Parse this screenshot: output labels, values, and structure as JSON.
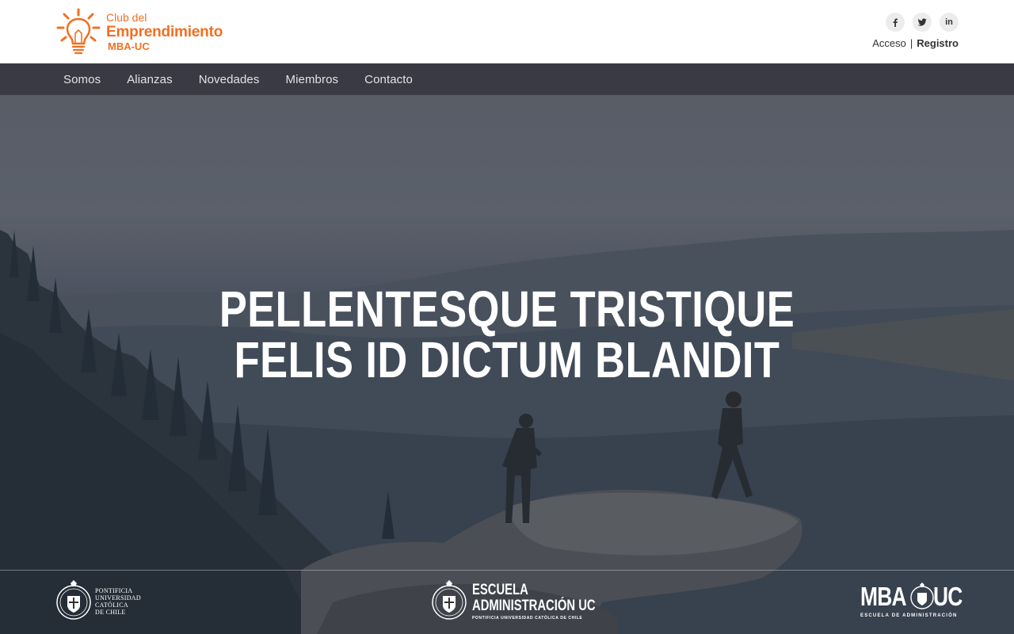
{
  "brand": {
    "line1": "Club del",
    "line2": "Emprendimiento",
    "line3": "MBA-UC",
    "color": "#f26f21"
  },
  "social": [
    {
      "icon": "facebook-icon",
      "glyph": "f"
    },
    {
      "icon": "twitter-icon",
      "glyph": ""
    },
    {
      "icon": "linkedin-icon",
      "glyph": "in"
    }
  ],
  "auth": {
    "login_label": "Acceso",
    "separator": "|",
    "register_label": "Registro"
  },
  "nav": {
    "items": [
      {
        "label": "Somos"
      },
      {
        "label": "Alianzas"
      },
      {
        "label": "Novedades"
      },
      {
        "label": "Miembros"
      },
      {
        "label": "Contacto"
      }
    ],
    "background": "#3a3a44"
  },
  "hero": {
    "title_line1": "PELLENTESQUE TRISTIQUE",
    "title_line2": "FELIS ID DICTUM BLANDIT"
  },
  "partners": {
    "puc": {
      "line1": "PONTIFICIA",
      "line2": "UNIVERSIDAD",
      "line3": "CATÓLICA",
      "line4": "DE CHILE"
    },
    "escuela": {
      "line1": "ESCUELA",
      "line2": "ADMINISTRACIÓN UC",
      "subtitle": "PONTIFICIA UNIVERSIDAD CATÓLICA DE CHILE"
    },
    "mba": {
      "left": "MBA",
      "right": "UC",
      "subtitle": "ESCUELA DE ADMINISTRACIÓN"
    }
  }
}
